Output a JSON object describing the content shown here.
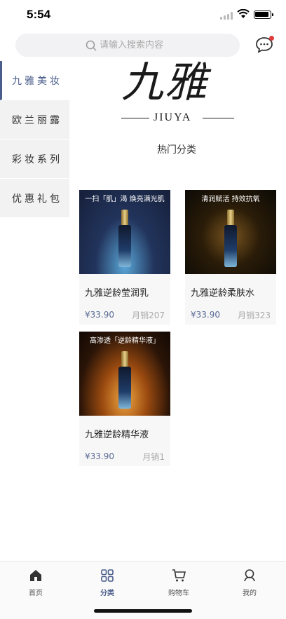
{
  "status": {
    "time": "5:54"
  },
  "search": {
    "placeholder": "请输入搜索内容"
  },
  "sidebar": {
    "items": [
      {
        "label": "九雅美妆",
        "active": true
      },
      {
        "label": "欧兰丽露",
        "active": false
      },
      {
        "label": "彩妆系列",
        "active": false
      },
      {
        "label": "优惠礼包",
        "active": false
      }
    ]
  },
  "brand": {
    "name_cn": "九雅",
    "name_en": "JIUYA"
  },
  "section": {
    "title": "热门分类"
  },
  "products": [
    {
      "name": "九雅逆龄莹润乳",
      "price": "¥33.90",
      "sales": "月销207",
      "image_caption": "一扫「肌」渴 焕亮满光肌"
    },
    {
      "name": "九雅逆龄柔肤水",
      "price": "¥33.90",
      "sales": "月销323",
      "image_caption": "清润赋活 持效抗氧"
    },
    {
      "name": "九雅逆龄精华液",
      "price": "¥33.90",
      "sales": "月销1",
      "image_caption": "高渗透「逆龄精华液」"
    }
  ],
  "tabbar": {
    "items": [
      {
        "label": "首页",
        "icon": "home-icon"
      },
      {
        "label": "分类",
        "icon": "grid-icon"
      },
      {
        "label": "购物车",
        "icon": "cart-icon"
      },
      {
        "label": "我的",
        "icon": "user-icon"
      }
    ],
    "active": "分类"
  },
  "colors": {
    "accent": "#4a5d8b",
    "badge": "#e03b3b",
    "sidebar_bg": "#f2f2f2"
  }
}
